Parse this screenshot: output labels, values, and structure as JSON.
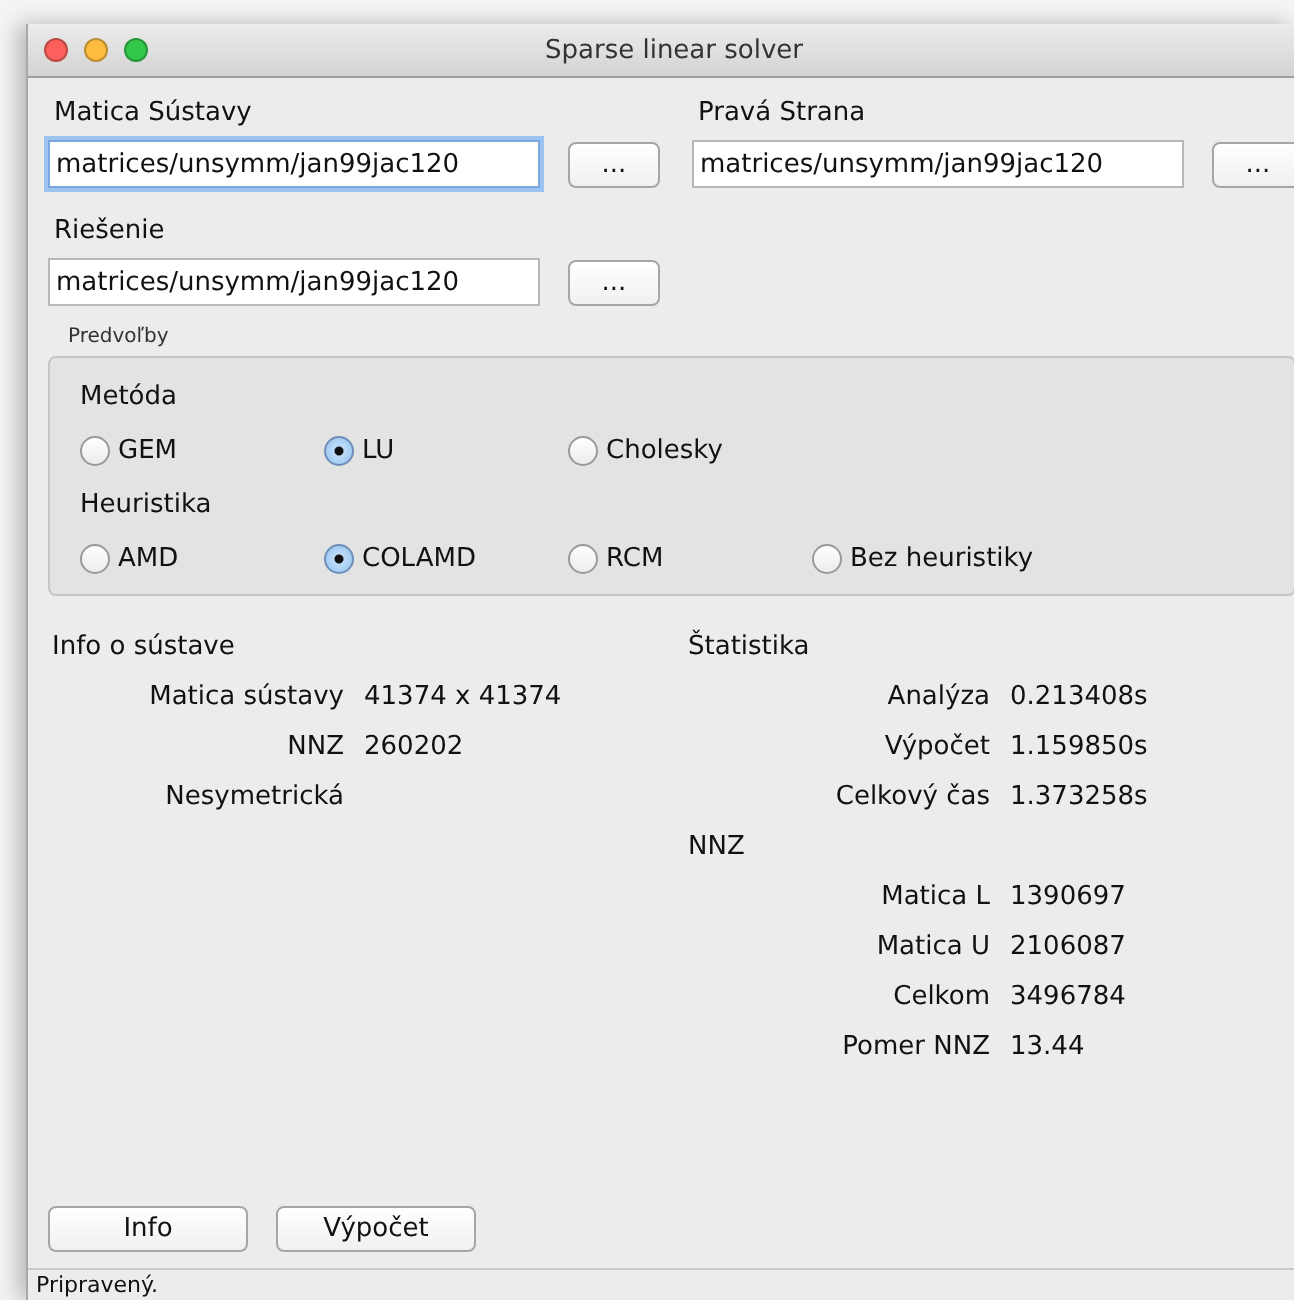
{
  "window": {
    "title": "Sparse linear solver"
  },
  "files": [
    {
      "label": "Matica Sústavy",
      "value": "matrices/unsymm/jan99jac120",
      "focused": true,
      "browse": "..."
    },
    {
      "label": "Pravá Strana",
      "value": "matrices/unsymm/jan99jac120",
      "focused": false,
      "browse": "..."
    },
    {
      "label": "Riešenie",
      "value": "matrices/unsymm/jan99jac120",
      "focused": false,
      "browse": "..."
    }
  ],
  "preferences": {
    "title": "Predvoľby",
    "groups": [
      {
        "label": "Metóda",
        "options": [
          {
            "label": "GEM",
            "selected": false
          },
          {
            "label": "LU",
            "selected": true
          },
          {
            "label": "Cholesky",
            "selected": false
          }
        ]
      },
      {
        "label": "Heuristika",
        "options": [
          {
            "label": "AMD",
            "selected": false
          },
          {
            "label": "COLAMD",
            "selected": true
          },
          {
            "label": "RCM",
            "selected": false
          },
          {
            "label": "Bez heuristiky",
            "selected": false
          }
        ]
      }
    ]
  },
  "info": {
    "title": "Info o sústave",
    "rows": [
      {
        "label": "Matica sústavy",
        "value": "41374 x 41374"
      },
      {
        "label": "NNZ",
        "value": "260202"
      },
      {
        "label": "Nesymetrická"
      }
    ]
  },
  "statistics": {
    "title": "Štatistika",
    "rows": [
      {
        "label": "Analýza",
        "value": "0.213408s"
      },
      {
        "label": "Výpočet",
        "value": "1.159850s"
      },
      {
        "label": "Celkový čas",
        "value": "1.373258s"
      }
    ],
    "nnz_title": "NNZ",
    "nnz_rows": [
      {
        "label": "Matica L",
        "value": "1390697"
      },
      {
        "label": "Matica U",
        "value": "2106087"
      },
      {
        "label": "Celkom",
        "value": "3496784"
      },
      {
        "label": "Pomer NNZ",
        "value": "13.44"
      }
    ]
  },
  "buttons": [
    "Info",
    "Výpočet"
  ],
  "status_bar": "Pripravený."
}
